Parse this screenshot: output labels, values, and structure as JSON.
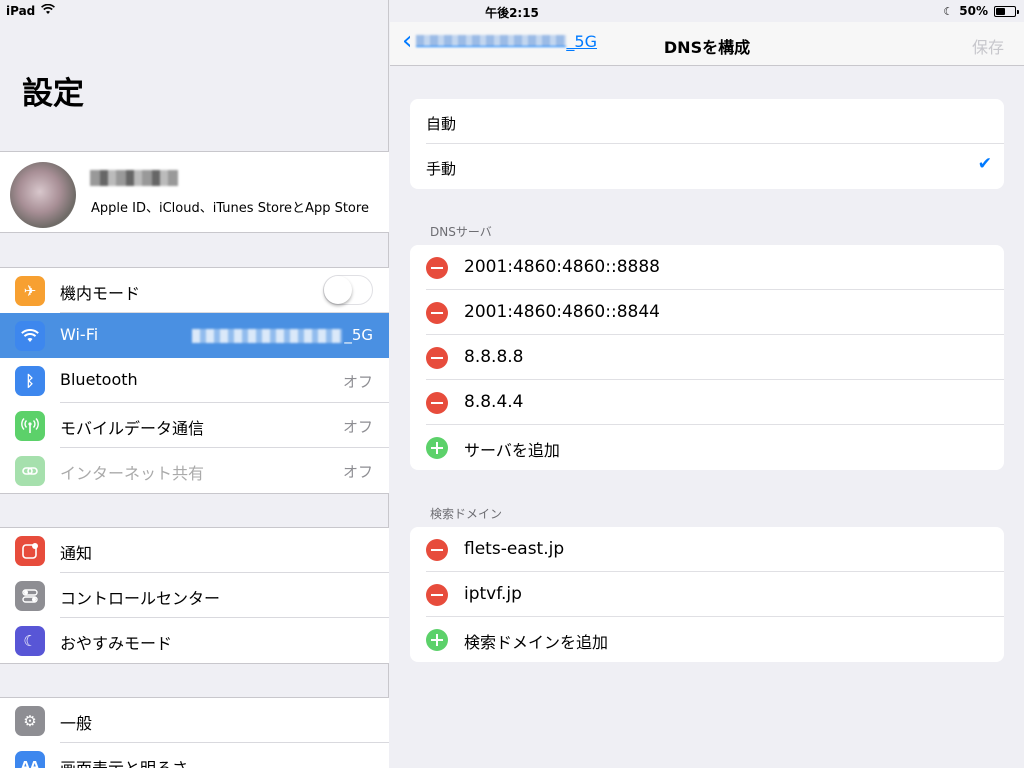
{
  "status": {
    "device": "iPad",
    "time": "午後2:15",
    "battery": "50%",
    "battery_level": 0.5
  },
  "left": {
    "title": "設定",
    "profile": {
      "subtitle": "Apple ID、iCloud、iTunes StoreとApp Store"
    },
    "group1": [
      {
        "label": "機内モード",
        "value": "",
        "icon": "airplane-icon",
        "color": "#f7a031"
      },
      {
        "label": "Wi-Fi",
        "value": "_5G",
        "icon": "wifi-icon",
        "color": "#3d87ee"
      },
      {
        "label": "Bluetooth",
        "value": "オフ",
        "icon": "bluetooth-icon",
        "color": "#3d87ee"
      },
      {
        "label": "モバイルデータ通信",
        "value": "オフ",
        "icon": "antenna-icon",
        "color": "#5cd16a"
      },
      {
        "label": "インターネット共有",
        "value": "オフ",
        "icon": "link-icon",
        "color": "#a6e0ad"
      }
    ],
    "group2": [
      {
        "label": "通知",
        "icon": "notification-icon",
        "color": "#e74c3c"
      },
      {
        "label": "コントロールセンター",
        "icon": "switches-icon",
        "color": "#8e8e93"
      },
      {
        "label": "おやすみモード",
        "icon": "moon-icon",
        "color": "#5856d6"
      }
    ],
    "group3": [
      {
        "label": "一般",
        "icon": "gear-icon",
        "color": "#8e8e93"
      },
      {
        "label": "画面表示と明るさ",
        "icon": "textsize-icon",
        "color": "#3d87ee"
      }
    ]
  },
  "right": {
    "nav": {
      "back_suffix": "_5G",
      "title": "DNSを構成",
      "save": "保存"
    },
    "mode": {
      "auto": "自動",
      "manual": "手動"
    },
    "dns_header": "DNSサーバ",
    "dns_servers": [
      "2001:4860:4860::8888",
      "2001:4860:4860::8844",
      "8.8.8.8",
      "8.8.4.4"
    ],
    "add_server": "サーバを追加",
    "search_header": "検索ドメイン",
    "search_domains": [
      "flets-east.jp",
      "iptvf.jp"
    ],
    "add_domain": "検索ドメインを追加"
  }
}
